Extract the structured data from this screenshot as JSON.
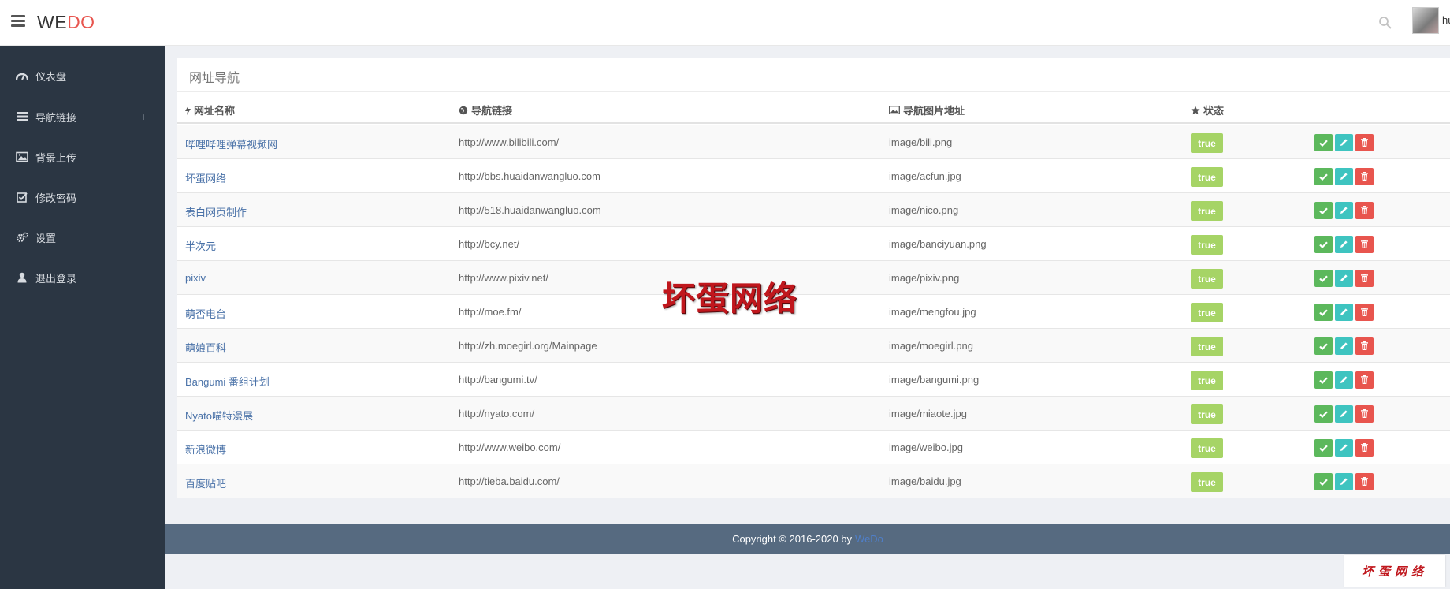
{
  "header": {
    "logo_we": "WE",
    "logo_do": "DO",
    "username": "hu"
  },
  "sidebar": {
    "items": [
      {
        "label": "仪表盘",
        "icon": "dashboard-icon"
      },
      {
        "label": "导航链接",
        "icon": "grid-icon",
        "expand": "+"
      },
      {
        "label": "背景上传",
        "icon": "image-icon"
      },
      {
        "label": "修改密码",
        "icon": "check-square-icon"
      },
      {
        "label": "设置",
        "icon": "gears-icon"
      },
      {
        "label": "退出登录",
        "icon": "user-icon"
      }
    ]
  },
  "panel": {
    "title": "网址导航"
  },
  "table": {
    "headers": {
      "name": "网址名称",
      "url": "导航链接",
      "image": "导航图片地址",
      "status": "状态"
    },
    "rows": [
      {
        "name": "哔哩哔哩弹幕视频网",
        "url": "http://www.bilibili.com/",
        "image": "image/bili.png",
        "status": "true"
      },
      {
        "name": "坏蛋网络",
        "url": "http://bbs.huaidanwangluo.com",
        "image": "image/acfun.jpg",
        "status": "true"
      },
      {
        "name": "表白网页制作",
        "url": "http://518.huaidanwangluo.com",
        "image": "image/nico.png",
        "status": "true"
      },
      {
        "name": "半次元",
        "url": "http://bcy.net/",
        "image": "image/banciyuan.png",
        "status": "true"
      },
      {
        "name": "pixiv",
        "url": "http://www.pixiv.net/",
        "image": "image/pixiv.png",
        "status": "true"
      },
      {
        "name": "萌否电台",
        "url": "http://moe.fm/",
        "image": "image/mengfou.jpg",
        "status": "true"
      },
      {
        "name": "萌娘百科",
        "url": "http://zh.moegirl.org/Mainpage",
        "image": "image/moegirl.png",
        "status": "true"
      },
      {
        "name": "Bangumi 番组计划",
        "url": "http://bangumi.tv/",
        "image": "image/bangumi.png",
        "status": "true"
      },
      {
        "name": "Nyato喵特漫展",
        "url": "http://nyato.com/",
        "image": "image/miaote.jpg",
        "status": "true"
      },
      {
        "name": "新浪微博",
        "url": "http://www.weibo.com/",
        "image": "image/weibo.jpg",
        "status": "true"
      },
      {
        "name": "百度贴吧",
        "url": "http://tieba.baidu.com/",
        "image": "image/baidu.jpg",
        "status": "true"
      }
    ]
  },
  "watermark": "坏蛋网络",
  "footer": {
    "text": "Copyright © 2016-2020 by",
    "brand": "WeDo"
  },
  "corner_logo": "坏蛋网络",
  "colors": {
    "accent": "#e8554e",
    "sidebar": "#2b3643",
    "badge": "#a6d466",
    "ok": "#5cb85c",
    "edit": "#3ec4c0",
    "delete": "#e8554e",
    "footer": "#566a80"
  }
}
